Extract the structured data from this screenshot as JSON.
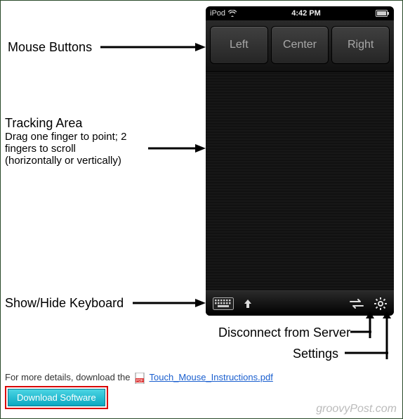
{
  "labels": {
    "mouse_buttons": "Mouse Buttons",
    "tracking_title": "Tracking Area",
    "tracking_sub1": "Drag one finger to point; 2",
    "tracking_sub2": "fingers to scroll",
    "tracking_sub3": "(horizontally or vertically)",
    "show_hide_kb": "Show/Hide Keyboard",
    "disconnect": "Disconnect from Server",
    "settings": "Settings"
  },
  "device": {
    "status": {
      "carrier": "iPod",
      "time": "4:42 PM"
    },
    "buttons": {
      "left": "Left",
      "center": "Center",
      "right": "Right"
    }
  },
  "details": {
    "prefix": "For more details, download the",
    "link_text": "Touch_Mouse_Instructions.pdf"
  },
  "download_button": "Download Software",
  "watermark": "groovyPost.com"
}
